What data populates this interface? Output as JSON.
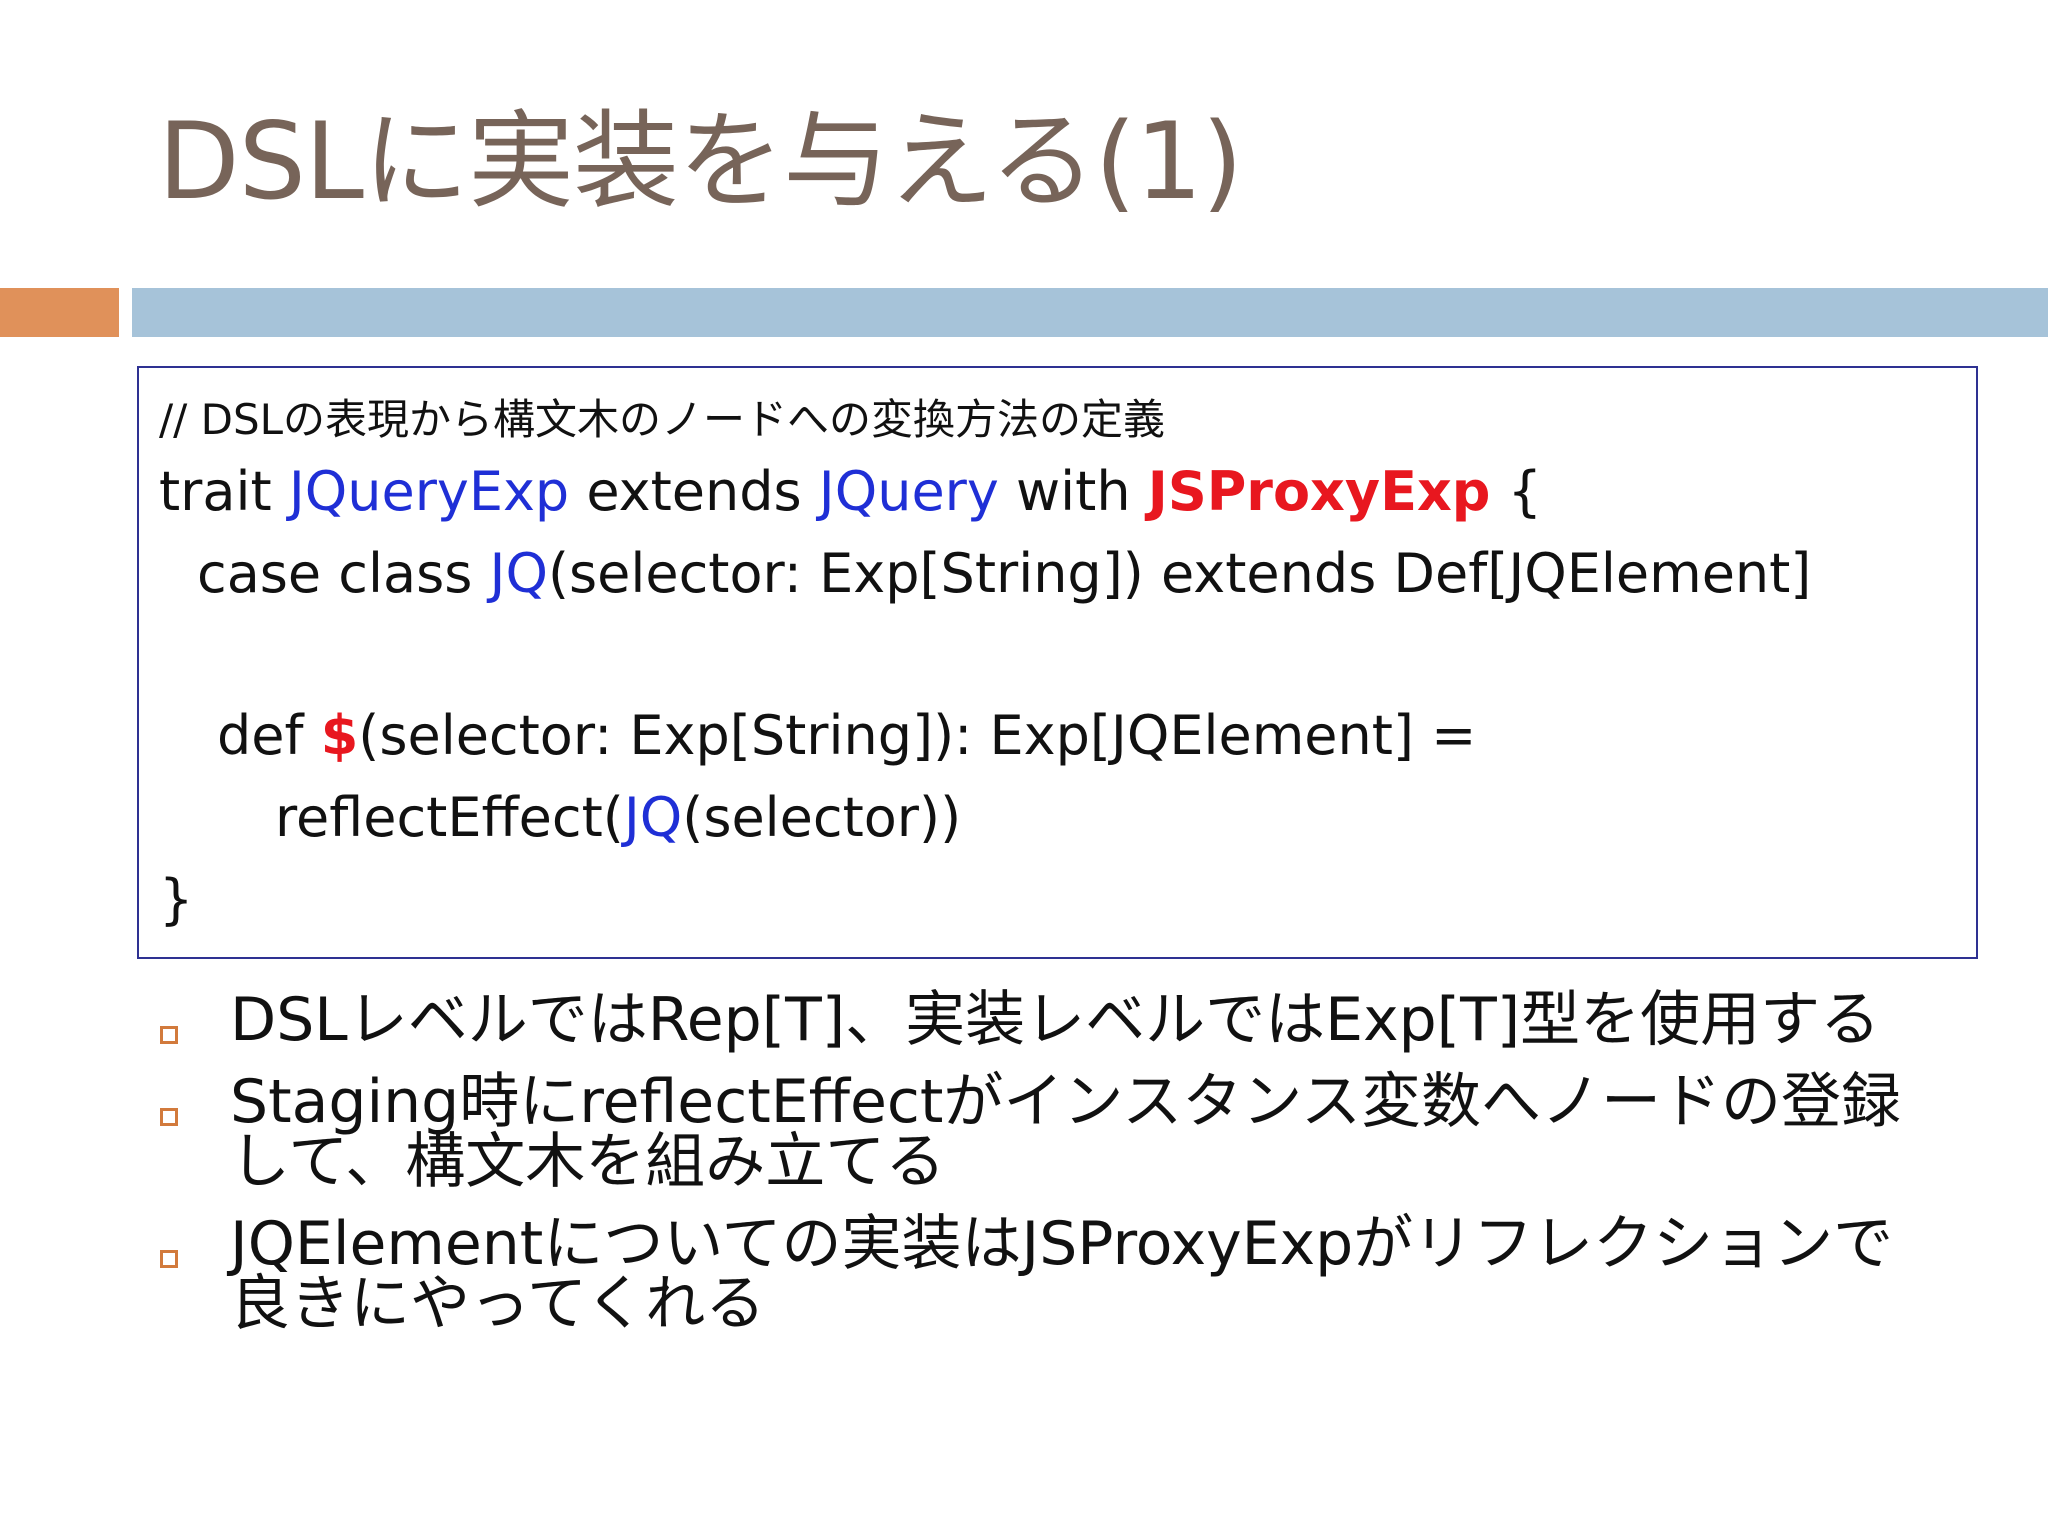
{
  "title": "DSLに実装を与える(1)",
  "colors": {
    "title": "#776459",
    "accent_orange": "#e0915a",
    "accent_blue": "#a6c3d9",
    "code_border": "#2e3192",
    "keyword_blue": "#1f2fd6",
    "keyword_red": "#e8171f",
    "bullet_marker": "#d27a3c"
  },
  "code": {
    "comment": "// DSLの表現から構文木のノードへの変換方法の定義",
    "line1": {
      "p1": "trait ",
      "p2": "JQueryExp",
      "p3": " extends ",
      "p4": "JQuery",
      "p5": " with ",
      "p6": "JSProxyExp",
      "p7": " {"
    },
    "line2": {
      "p1": "case class ",
      "p2": "JQ",
      "p3": "(selector: Exp[String]) extends Def[JQElement]"
    },
    "line3": {
      "p1": "def ",
      "p2": "$",
      "p3": "(selector: Exp[String]): Exp[JQElement] ="
    },
    "line4": {
      "p1": "reflectEffect(",
      "p2": "JQ",
      "p3": "(selector))"
    },
    "line5": "}"
  },
  "bullets": [
    "DSLレベルではRep[T]、実装レベルではExp[T]型を使用する",
    "Staging時にreflectEffectがインスタンス変数へノードの登録して、構文木を組み立てる",
    "JQElementについての実装はJSProxyExpがリフレクションで良きにやってくれる"
  ]
}
